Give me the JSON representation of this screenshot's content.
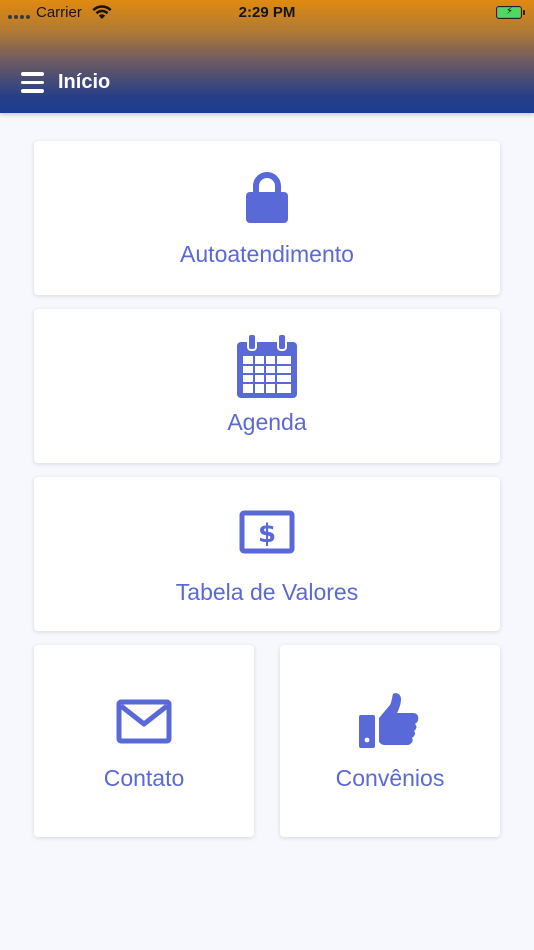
{
  "status_bar": {
    "carrier": "Carrier",
    "time": "2:29 PM",
    "battery": "charging"
  },
  "header": {
    "title": "Início",
    "menu_icon": "hamburger-menu-icon"
  },
  "accent_color": "#5a69d8",
  "cards": [
    {
      "label": "Autoatendimento",
      "icon": "lock-icon"
    },
    {
      "label": "Agenda",
      "icon": "calendar-icon"
    },
    {
      "label": "Tabela de Valores",
      "icon": "money-bill-icon"
    },
    {
      "label": "Contato",
      "icon": "envelope-icon"
    },
    {
      "label": "Convênios",
      "icon": "thumbs-up-icon"
    }
  ]
}
